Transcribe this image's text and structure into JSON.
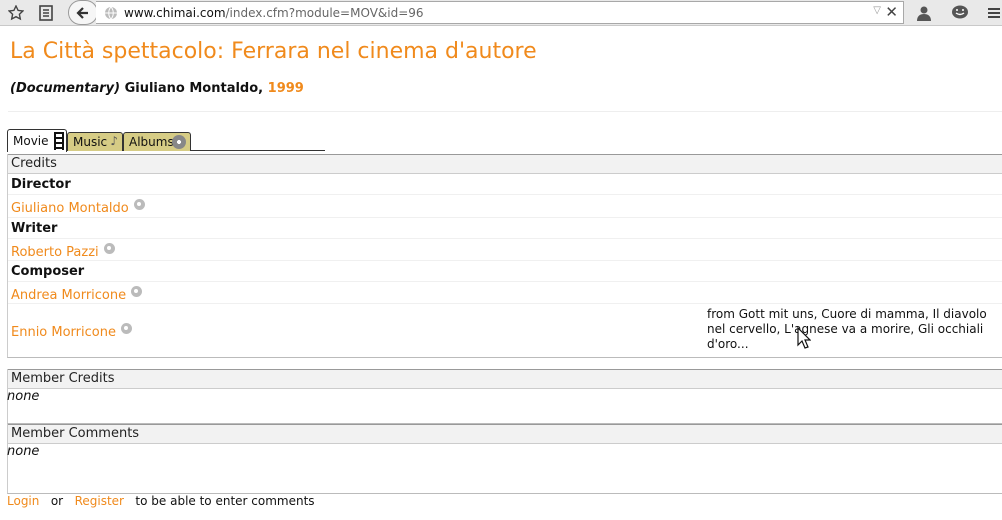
{
  "browser": {
    "url_domain": "www.chimai.com",
    "url_path": "/index.cfm?module=MOV&id=96",
    "icons": [
      "bookmark-star-icon",
      "reading-list-icon",
      "back-arrow-icon",
      "globe-icon",
      "dropdown-icon",
      "close-icon",
      "user-icon",
      "chat-icon",
      "menu-icon"
    ]
  },
  "movie": {
    "title": "La Città spettacolo: Ferrara nel cinema d'autore",
    "genre": "(Documentary)",
    "director_line": "Giuliano Montaldo,",
    "year": "1999"
  },
  "tabs": [
    {
      "label": "Movie",
      "icon": "film-icon",
      "active": true
    },
    {
      "label": "Music",
      "icon": "music-note-icon",
      "active": false
    },
    {
      "label": "Albums",
      "icon": "disc-icon",
      "active": false
    }
  ],
  "credits": {
    "header": "Credits",
    "director_role": "Director",
    "director_name": "Giuliano Montaldo",
    "writer_role": "Writer",
    "writer_name": "Roberto Pazzi",
    "composer_role": "Composer",
    "composer_1": "Andrea Morricone",
    "composer_2": "Ennio Morricone",
    "composer_2_note": "from Gott mit uns, Cuore di mamma, Il diavolo nel cervello, L'agnese va a morire, Gli occhiali d'oro..."
  },
  "member_credits": {
    "header": "Member Credits",
    "value": "none"
  },
  "member_comments": {
    "header": "Member Comments",
    "value": "none"
  },
  "footer": {
    "login": "Login",
    "or": "or",
    "register": "Register",
    "suffix": "to be able to enter comments"
  },
  "colors": {
    "accent": "#f08a1c",
    "tab_inactive": "#d6cc85"
  }
}
